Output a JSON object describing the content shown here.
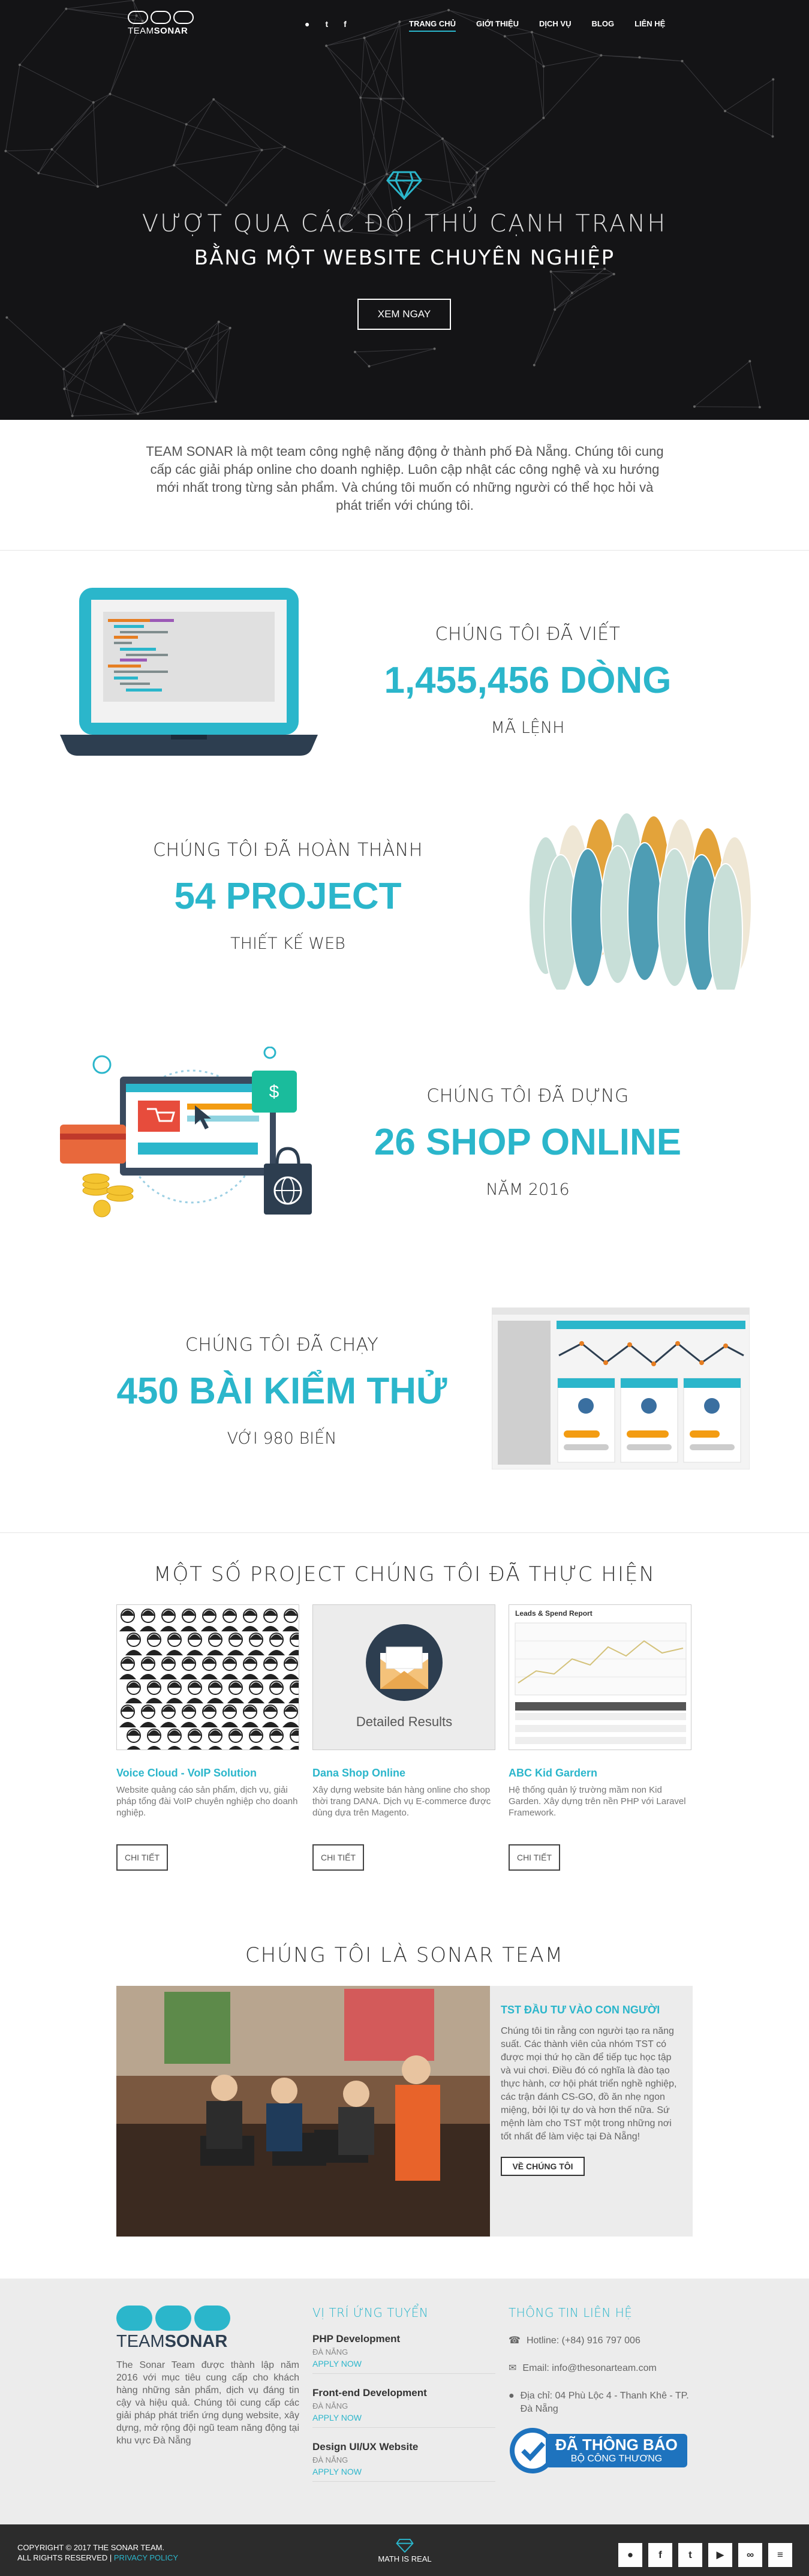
{
  "nav": {
    "logo_part1": "TEAM",
    "logo_part2": "SONAR",
    "social": [
      "github-icon",
      "twitter-icon",
      "facebook-icon"
    ],
    "social_glyphs": [
      "●",
      "t",
      "f"
    ],
    "menu": [
      "TRANG CHỦ",
      "GIỚI THIỆU",
      "DỊCH VỤ",
      "BLOG",
      "LIÊN HỆ"
    ]
  },
  "hero": {
    "title_line1": "VƯỢT QUA CÁC ĐỐI THỦ CẠNH TRANH",
    "title_line2": "BẰNG MỘT WEBSITE CHUYÊN NGHIỆP",
    "cta": "XEM NGAY"
  },
  "intro": "TEAM SONAR là một team công nghệ năng động ở thành phố Đà Nẵng. Chúng tôi cung cấp các giải pháp online cho doanh nghiệp. Luôn cập nhật các công nghệ và xu hướng mới nhất trong từng sản phẩm. Và chúng tôi muốn có những người có thể học hỏi và phát triển với chúng tôi.",
  "stats": [
    {
      "top": "CHÚNG TÔI ĐÃ VIẾT",
      "value": "1,455,456 DÒNG",
      "bottom": "MÃ LỆNH"
    },
    {
      "top": "CHÚNG TÔI ĐÃ HOÀN THÀNH",
      "value": "54 PROJECT",
      "bottom": "THIẾT KẾ WEB"
    },
    {
      "top": "CHÚNG TÔI ĐÃ DỰNG",
      "value": "26 SHOP ONLINE",
      "bottom": "NĂM 2016"
    },
    {
      "top": "CHÚNG TÔI ĐÃ CHẠY",
      "value": "450 BÀI KIỂM THỬ",
      "bottom": "VỚI 980 BIẾN"
    }
  ],
  "projects": {
    "title": "MỘT SỐ PROJECT CHÚNG TÔI ĐÃ THỰC HIỆN",
    "items": [
      {
        "name": "Voice Cloud - VoIP Solution",
        "desc": "Website quảng cáo sản phẩm, dịch vụ, giải pháp tổng đài VoIP chuyên nghiệp cho doanh nghiệp.",
        "button": "CHI TIẾT"
      },
      {
        "name": "Dana Shop Online",
        "desc": "Xây dựng website bán hàng online cho shop thời trang DANA. Dịch vụ E-commerce được dùng dựa trên Magento.",
        "button": "CHI TIẾT",
        "image_text": "Detailed Results"
      },
      {
        "name": "ABC Kid Gardern",
        "desc": "Hệ thống quản lý trường mầm non Kid Garden. Xây dựng trên nền PHP với Laravel Framework.",
        "button": "CHI TIẾT",
        "image_text": "Leads & Spend Report"
      }
    ]
  },
  "team": {
    "title": "CHÚNG TÔI LÀ SONAR TEAM",
    "heading": "TST ĐẦU TƯ VÀO CON NGƯỜI",
    "body": "Chúng tôi tin rằng con người tạo ra năng suất. Các thành viên của nhóm TST có được mọi thứ họ cần để tiếp tục học tập và vui chơi. Điều đó có nghĩa là đào tạo thực hành, cơ hội phát triển nghề nghiệp, các trận đánh CS-GO, đồ ăn nhẹ ngon miệng, bởi lội tự do và hơn thế nữa. Sứ mệnh làm cho TST một trong những nơi tốt nhất để làm việc tại Đà Nẵng!",
    "button": "VỀ CHÚNG TÔI"
  },
  "footer": {
    "about": "The Sonar Team được thành lập năm 2016 với mục tiêu cung cấp cho khách hàng những sản phẩm, dịch vụ đáng tin cậy và hiệu quả. Chúng tôi cung cấp các giải pháp phát triển ứng dụng website, xây dựng, mở rộng đội ngũ team năng động tại khu vực Đà Nẵng",
    "jobs_title": "VỊ TRÍ ỨNG TUYỂN",
    "jobs": [
      {
        "title": "PHP Development",
        "location": "ĐÀ NẴNG",
        "apply": "APPLY NOW"
      },
      {
        "title": "Front-end Development",
        "location": "ĐÀ NẴNG",
        "apply": "APPLY NOW"
      },
      {
        "title": "Design UI/UX Website",
        "location": "ĐÀ NẴNG",
        "apply": "APPLY NOW"
      }
    ],
    "contact_title": "THÔNG TIN LIÊN HỆ",
    "hotline": "Hotline: (+84) 916 797 006",
    "email": "Email: info@thesonarteam.com",
    "address": "Địa chỉ: 04 Phù Lộc 4 - Thanh Khê - TP. Đà Nẵng",
    "badge_line1": "ĐÃ THÔNG BÁO",
    "badge_line2": "BỘ CÔNG THƯƠNG",
    "copyright_line1": "COPYRIGHT © 2017 THE SONAR TEAM.",
    "copyright_line2": "ALL RIGHTS RESERVED",
    "privacy": "PRIVACY POLICY",
    "motto": "MATH IS REAL",
    "social": [
      "github-icon",
      "facebook-icon",
      "twitter-icon",
      "youtube-icon",
      "link-icon",
      "rss-icon"
    ],
    "social_glyphs": [
      "●",
      "f",
      "t",
      "▶",
      "∞",
      "≡"
    ]
  }
}
